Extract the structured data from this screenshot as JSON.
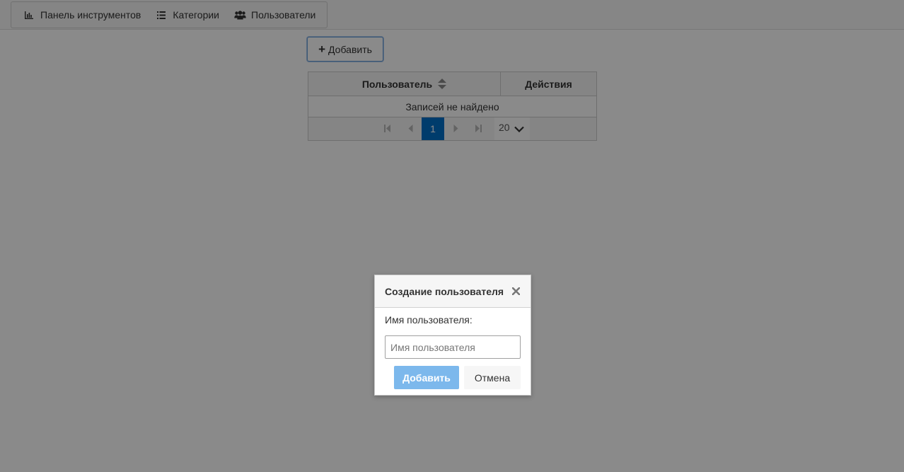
{
  "nav": {
    "items": [
      {
        "label": "Панель инструментов",
        "icon": "bar-chart-icon"
      },
      {
        "label": "Категории",
        "icon": "list-icon"
      },
      {
        "label": "Пользователи",
        "icon": "users-icon"
      }
    ]
  },
  "toolbar": {
    "add_label": "Добавить",
    "add_icon": "plus-icon"
  },
  "table": {
    "columns": [
      "Пользователь",
      "Действия"
    ],
    "sort_icon": "sort-icon",
    "empty_message": "Записей не найдено",
    "paginator": {
      "current_page": "1",
      "rows_per_page": "20"
    }
  },
  "dialog": {
    "title": "Создание пользователя",
    "field_label": "Имя пользователя:",
    "input_value": "",
    "input_placeholder": "Имя пользователя",
    "submit_label": "Добавить",
    "cancel_label": "Отмена"
  },
  "colors": {
    "accent": "#0070c8",
    "primary_button": "#7cb8ec",
    "overlay": "rgba(0,0,0,0.46)"
  }
}
